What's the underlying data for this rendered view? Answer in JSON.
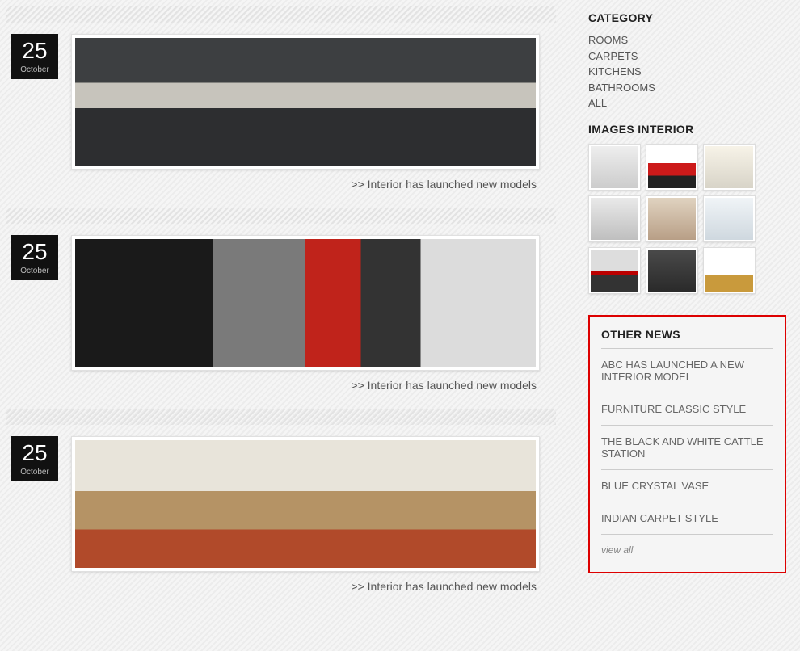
{
  "posts": [
    {
      "day": "25",
      "month": "October",
      "link": ">> Interior has launched new models",
      "imgClass": "room1"
    },
    {
      "day": "25",
      "month": "October",
      "link": ">> Interior has launched new models",
      "imgClass": "room2"
    },
    {
      "day": "25",
      "month": "October",
      "link": ">> Interior has launched new models",
      "imgClass": "room3"
    }
  ],
  "sidebar": {
    "category": {
      "title": "CATEGORY",
      "items": [
        "ROOMS",
        "CARPETS",
        "KITCHENS",
        "BATHROOMS",
        "ALL"
      ]
    },
    "gallery": {
      "title": "IMAGES INTERIOR",
      "thumbs": [
        "t1",
        "t2",
        "t3",
        "t4",
        "t5",
        "t6",
        "t7",
        "t8",
        "t9"
      ]
    },
    "other_news": {
      "title": "OTHER NEWS",
      "items": [
        "ABC HAS LAUNCHED A NEW INTERIOR MODEL",
        "FURNITURE CLASSIC STYLE",
        "THE BLACK AND WHITE CATTLE STATION",
        "BLUE CRYSTAL VASE",
        "INDIAN CARPET STYLE"
      ],
      "view_all": "view all"
    }
  }
}
